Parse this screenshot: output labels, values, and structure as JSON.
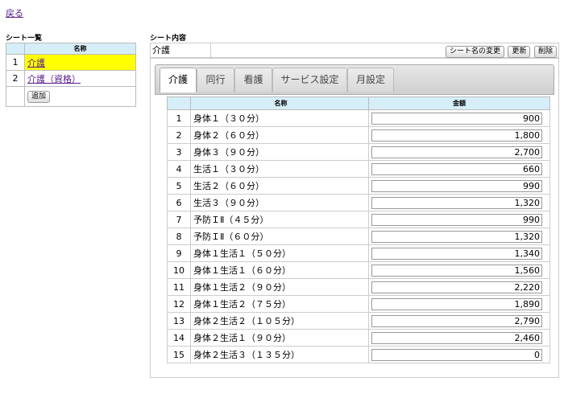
{
  "back_link": "戻る",
  "sheet_list": {
    "title": "シート一覧",
    "col_name": "名称",
    "items": [
      {
        "num": "1",
        "name": "介護",
        "selected": true
      },
      {
        "num": "2",
        "name": "介護（資格）",
        "selected": false
      }
    ],
    "add_button": "追加"
  },
  "sheet_content": {
    "title": "シート内容",
    "sheet_name": "介護",
    "buttons": {
      "rename": "シート名の変更",
      "update": "更新",
      "delete": "削除"
    },
    "tabs": [
      "介護",
      "同行",
      "看護",
      "サービス設定",
      "月設定"
    ],
    "active_tab": "介護",
    "table": {
      "col_name": "名称",
      "col_amount": "金額",
      "rows": [
        {
          "num": "1",
          "name": "身体１（３０分）",
          "amount": "900"
        },
        {
          "num": "2",
          "name": "身体２（６０分）",
          "amount": "1,800"
        },
        {
          "num": "3",
          "name": "身体３（９０分）",
          "amount": "2,700"
        },
        {
          "num": "4",
          "name": "生活１（３０分）",
          "amount": "660"
        },
        {
          "num": "5",
          "name": "生活２（６０分）",
          "amount": "990"
        },
        {
          "num": "6",
          "name": "生活３（９０分）",
          "amount": "1,320"
        },
        {
          "num": "7",
          "name": "予防ＩⅡ（４５分）",
          "amount": "990"
        },
        {
          "num": "8",
          "name": "予防ＩⅡ（６０分）",
          "amount": "1,320"
        },
        {
          "num": "9",
          "name": "身体１生活１（５０分）",
          "amount": "1,340"
        },
        {
          "num": "10",
          "name": "身体１生活１（６０分）",
          "amount": "1,560"
        },
        {
          "num": "11",
          "name": "身体１生活２（９０分）",
          "amount": "2,220"
        },
        {
          "num": "12",
          "name": "身体１生活２（７５分）",
          "amount": "1,890"
        },
        {
          "num": "13",
          "name": "身体２生活２（１０５分）",
          "amount": "2,790"
        },
        {
          "num": "14",
          "name": "身体２生活１（９０分）",
          "amount": "2,460"
        },
        {
          "num": "15",
          "name": "身体２生活３（１３５分）",
          "amount": "0"
        }
      ]
    }
  },
  "colors": {
    "header_bg": "#d6eef8",
    "selected_bg": "#ffff00",
    "link": "#551a8b"
  }
}
